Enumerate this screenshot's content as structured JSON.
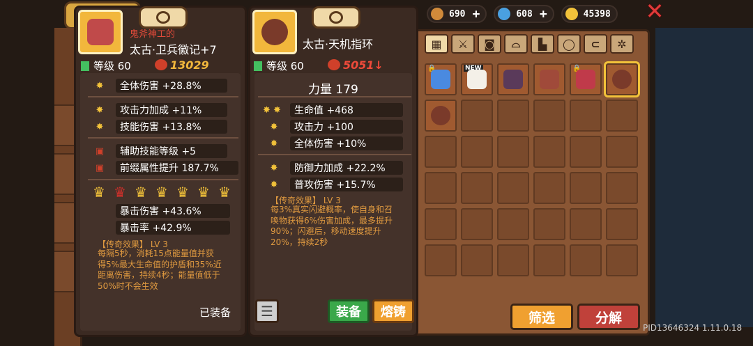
{
  "topbar": {
    "resources": [
      {
        "icon": "ore-icon",
        "value": "690",
        "color": "#d08a3a"
      },
      {
        "icon": "gem-icon",
        "value": "608",
        "color": "#4aa0e0"
      },
      {
        "icon": "gold-coin-icon",
        "value": "45398",
        "color": "#f2c23a"
      }
    ],
    "plus": "+"
  },
  "card1": {
    "subtitle": "鬼斧神工的",
    "name": "太古·卫兵徽记+7",
    "level": "等级 60",
    "power": "13029",
    "stats": [
      {
        "icon": "star",
        "text": "全体伤害 +28.8%"
      },
      {
        "icon": "star",
        "text": "攻击力加成 +11%"
      },
      {
        "icon": "star",
        "text": "技能伤害 +13.8%"
      },
      {
        "icon": "scroll",
        "text": "辅助技能等级 +5"
      },
      {
        "icon": "scroll",
        "text": "前缀属性提升 187.7%"
      },
      {
        "icon": "none",
        "text": "暴击伤害 +43.6%"
      },
      {
        "icon": "none",
        "text": "暴击率 +42.9%"
      }
    ],
    "crowns": 7,
    "legend_title": "【传奇效果】 LV 3",
    "legend_body": [
      "每隔5秒，消耗15点能量值并获",
      "得5%最大生命值的护盾和35%近",
      "距离伤害，持续4秒；能量值低于",
      "50%时不会生效"
    ],
    "equipped": "已装备"
  },
  "card2": {
    "name": "太古·天机指环",
    "level": "等级 60",
    "power": "5051",
    "main_stat": "力量 179",
    "stats": [
      {
        "icon": "star2",
        "text": "生命值 +468"
      },
      {
        "icon": "star",
        "text": "攻击力 +100"
      },
      {
        "icon": "star",
        "text": "全体伤害 +10%"
      },
      {
        "icon": "star",
        "text": "防御力加成 +22.2%"
      },
      {
        "icon": "star",
        "text": "普攻伤害 +15.7%"
      }
    ],
    "legend_title": "【传奇效果】 LV 3",
    "legend_body": [
      "每3%真实闪避概率，使自身和召",
      "唤物获得6%伤害加成，最多提升",
      "90%；闪避后，移动速度提升",
      "20%，持续2秒"
    ],
    "equip_button": "装备",
    "forge_button": "熔铸"
  },
  "inventory": {
    "tabs": [
      "grid-icon",
      "sword-icon",
      "armor-icon",
      "helmet-icon",
      "boots-icon",
      "ring-icon",
      "amulet-icon",
      "gear-icon"
    ],
    "new_badge": "NEW"
  },
  "buttons": {
    "filter": "筛选",
    "decompose": "分解"
  },
  "footer": {
    "pid": "PID13646324 1.11.0.18"
  }
}
